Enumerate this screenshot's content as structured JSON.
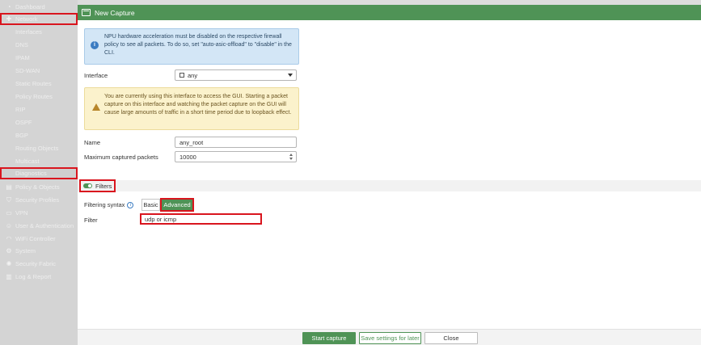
{
  "sidebar": {
    "items": [
      {
        "label": "Dashboard",
        "icon": "dashboard-icon",
        "glyph": "◔"
      },
      {
        "label": "Network",
        "icon": "network-icon",
        "glyph": "✚"
      },
      {
        "label": "Interfaces"
      },
      {
        "label": "DNS"
      },
      {
        "label": "IPAM"
      },
      {
        "label": "SD-WAN"
      },
      {
        "label": "Static Routes"
      },
      {
        "label": "Policy Routes"
      },
      {
        "label": "RIP"
      },
      {
        "label": "OSPF"
      },
      {
        "label": "BGP"
      },
      {
        "label": "Routing Objects"
      },
      {
        "label": "Multicast"
      },
      {
        "label": "Diagnostics"
      },
      {
        "label": "Policy & Objects",
        "icon": "policy-icon",
        "glyph": "▤"
      },
      {
        "label": "Security Profiles",
        "icon": "shield-icon",
        "glyph": "⛉"
      },
      {
        "label": "VPN",
        "icon": "vpn-icon",
        "glyph": "▭"
      },
      {
        "label": "User & Authentication",
        "icon": "user-icon",
        "glyph": "☺"
      },
      {
        "label": "WiFi Controller",
        "icon": "wifi-icon",
        "glyph": "◠"
      },
      {
        "label": "System",
        "icon": "gear-icon",
        "glyph": "⚙"
      },
      {
        "label": "Security Fabric",
        "icon": "fabric-icon",
        "glyph": "✺"
      },
      {
        "label": "Log & Report",
        "icon": "chart-icon",
        "glyph": "▥"
      }
    ]
  },
  "modal": {
    "title": "New Capture",
    "info_text": "NPU hardware acceleration must be disabled on the respective firewall policy to see all packets. To do so, set \"auto-asic-offload\" to \"disable\" in the CLI.",
    "interface_label": "Interface",
    "interface_value": "any",
    "warning_text": "You are currently using this interface to access the GUI. Starting a packet capture on this interface and watching the packet capture on the GUI will cause large amounts of traffic in a short time period due to loopback effect.",
    "name_label": "Name",
    "name_value": "any_root",
    "max_packets_label": "Maximum captured packets",
    "max_packets_value": "10000",
    "filters_label": "Filters",
    "filtering_syntax_label": "Filtering syntax",
    "syntax_basic": "Basic",
    "syntax_advanced": "Advanced",
    "filter_label": "Filter",
    "filter_value": "udp or icmp",
    "start_button": "Start capture",
    "save_button": "Save settings for later",
    "close_button": "Close"
  },
  "colors": {
    "accent": "#4f9356",
    "highlight": "#d9151e",
    "info_bg": "#d3e6f6",
    "warning_bg": "#fbf2cc"
  }
}
